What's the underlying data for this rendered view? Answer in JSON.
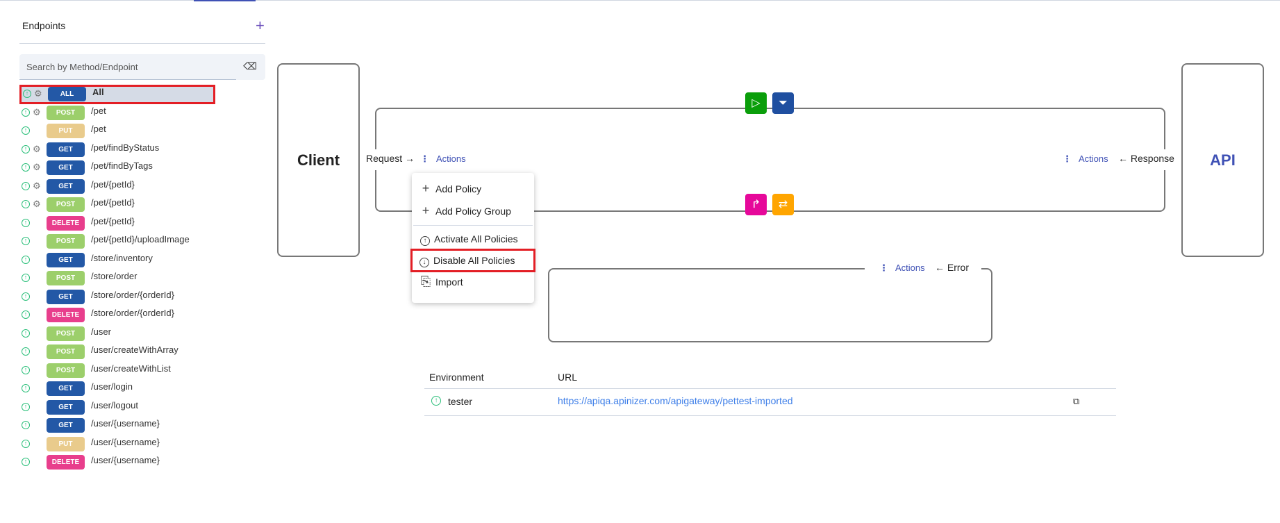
{
  "sidebar": {
    "title": "Endpoints",
    "add_icon": "plus-icon",
    "search_placeholder": "Search by Method/Endpoint",
    "items": [
      {
        "method": "ALL",
        "path": "All",
        "color": "#2358a6",
        "gear": true,
        "selected": true
      },
      {
        "method": "POST",
        "path": "/pet",
        "color": "#9ccf6b",
        "gear": true
      },
      {
        "method": "PUT",
        "path": "/pet",
        "color": "#e9cb8c",
        "gear": false
      },
      {
        "method": "GET",
        "path": "/pet/findByStatus",
        "color": "#2358a6",
        "gear": true
      },
      {
        "method": "GET",
        "path": "/pet/findByTags",
        "color": "#2358a6",
        "gear": true
      },
      {
        "method": "GET",
        "path": "/pet/{petId}",
        "color": "#2358a6",
        "gear": true
      },
      {
        "method": "POST",
        "path": "/pet/{petId}",
        "color": "#9ccf6b",
        "gear": true
      },
      {
        "method": "DELETE",
        "path": "/pet/{petId}",
        "color": "#e83e8c",
        "gear": false
      },
      {
        "method": "POST",
        "path": "/pet/{petId}/uploadImage",
        "color": "#9ccf6b",
        "gear": false
      },
      {
        "method": "GET",
        "path": "/store/inventory",
        "color": "#2358a6",
        "gear": false
      },
      {
        "method": "POST",
        "path": "/store/order",
        "color": "#9ccf6b",
        "gear": false
      },
      {
        "method": "GET",
        "path": "/store/order/{orderId}",
        "color": "#2358a6",
        "gear": false
      },
      {
        "method": "DELETE",
        "path": "/store/order/{orderId}",
        "color": "#e83e8c",
        "gear": false
      },
      {
        "method": "POST",
        "path": "/user",
        "color": "#9ccf6b",
        "gear": false
      },
      {
        "method": "POST",
        "path": "/user/createWithArray",
        "color": "#9ccf6b",
        "gear": false
      },
      {
        "method": "POST",
        "path": "/user/createWithList",
        "color": "#9ccf6b",
        "gear": false
      },
      {
        "method": "GET",
        "path": "/user/login",
        "color": "#2358a6",
        "gear": false
      },
      {
        "method": "GET",
        "path": "/user/logout",
        "color": "#2358a6",
        "gear": false
      },
      {
        "method": "GET",
        "path": "/user/{username}",
        "color": "#2358a6",
        "gear": false
      },
      {
        "method": "PUT",
        "path": "/user/{username}",
        "color": "#e9cb8c",
        "gear": false
      },
      {
        "method": "DELETE",
        "path": "/user/{username}",
        "color": "#e83e8c",
        "gear": false
      }
    ]
  },
  "flow": {
    "client": "Client",
    "api": "API",
    "request_label": "Request →",
    "response_label": "← Response",
    "error_label": "← Error",
    "actions_label": "Actions",
    "request_policies": [
      {
        "icon": "play-icon",
        "glyph": "▷",
        "color": "#0a9e0a"
      },
      {
        "icon": "filter-icon",
        "glyph": "⏷",
        "color": "#1f4fa0"
      }
    ],
    "response_policies": [
      {
        "icon": "redirect-icon",
        "glyph": "↱",
        "color": "#e6089a"
      },
      {
        "icon": "swap-icon",
        "glyph": "⇄",
        "color": "#ffa500"
      }
    ]
  },
  "menu": {
    "items": [
      {
        "label": "Add Policy",
        "icon": "plus-icon",
        "glyph": "+"
      },
      {
        "label": "Add Policy Group",
        "icon": "plus-icon",
        "glyph": "+"
      },
      {
        "label": "Activate All Policies",
        "icon": "arrow-up-circle-icon",
        "glyph": "⊕"
      },
      {
        "label": "Disable All Policies",
        "icon": "arrow-down-circle-icon",
        "glyph": "⊕",
        "highlighted": true
      },
      {
        "label": "Import",
        "icon": "import-file-icon",
        "glyph": "⎘"
      }
    ]
  },
  "environments": {
    "headers": [
      "Environment",
      "URL"
    ],
    "rows": [
      {
        "name": "tester",
        "url": "https://apiqa.apinizer.com/apigateway/pettest-imported",
        "status": "active"
      }
    ]
  }
}
